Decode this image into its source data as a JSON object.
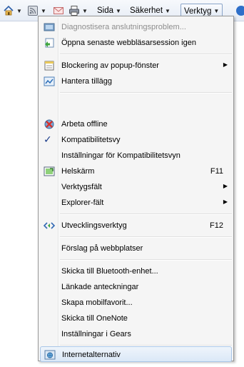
{
  "toolbar": {
    "sida_label": "Sida",
    "sakerhet_label": "Säkerhet",
    "verktyg_label": "Verktyg"
  },
  "menu": {
    "diagnose": "Diagnostisera anslutningsproblem...",
    "reopen_session": "Öppna senaste webbläsarsession igen",
    "popup_blocker": "Blockering av popup-fönster",
    "manage_addons": "Hantera tillägg",
    "work_offline": "Arbeta offline",
    "compat_view": "Kompatibilitetsvy",
    "compat_settings": "Inställningar för Kompatibilitetsvyn",
    "fullscreen": "Helskärm",
    "fullscreen_shortcut": "F11",
    "toolbars": "Verktygsfält",
    "explorer_bars": "Explorer-fält",
    "dev_tools": "Utvecklingsverktyg",
    "dev_tools_shortcut": "F12",
    "suggested_sites": "Förslag på webbplatser",
    "send_bluetooth": "Skicka till Bluetooth-enhet...",
    "linked_notes": "Länkade anteckningar",
    "mobile_favorite": "Skapa mobilfavorit...",
    "send_onenote": "Skicka till OneNote",
    "gears_settings": "Inställningar i Gears",
    "internet_options": "Internetalternativ"
  }
}
